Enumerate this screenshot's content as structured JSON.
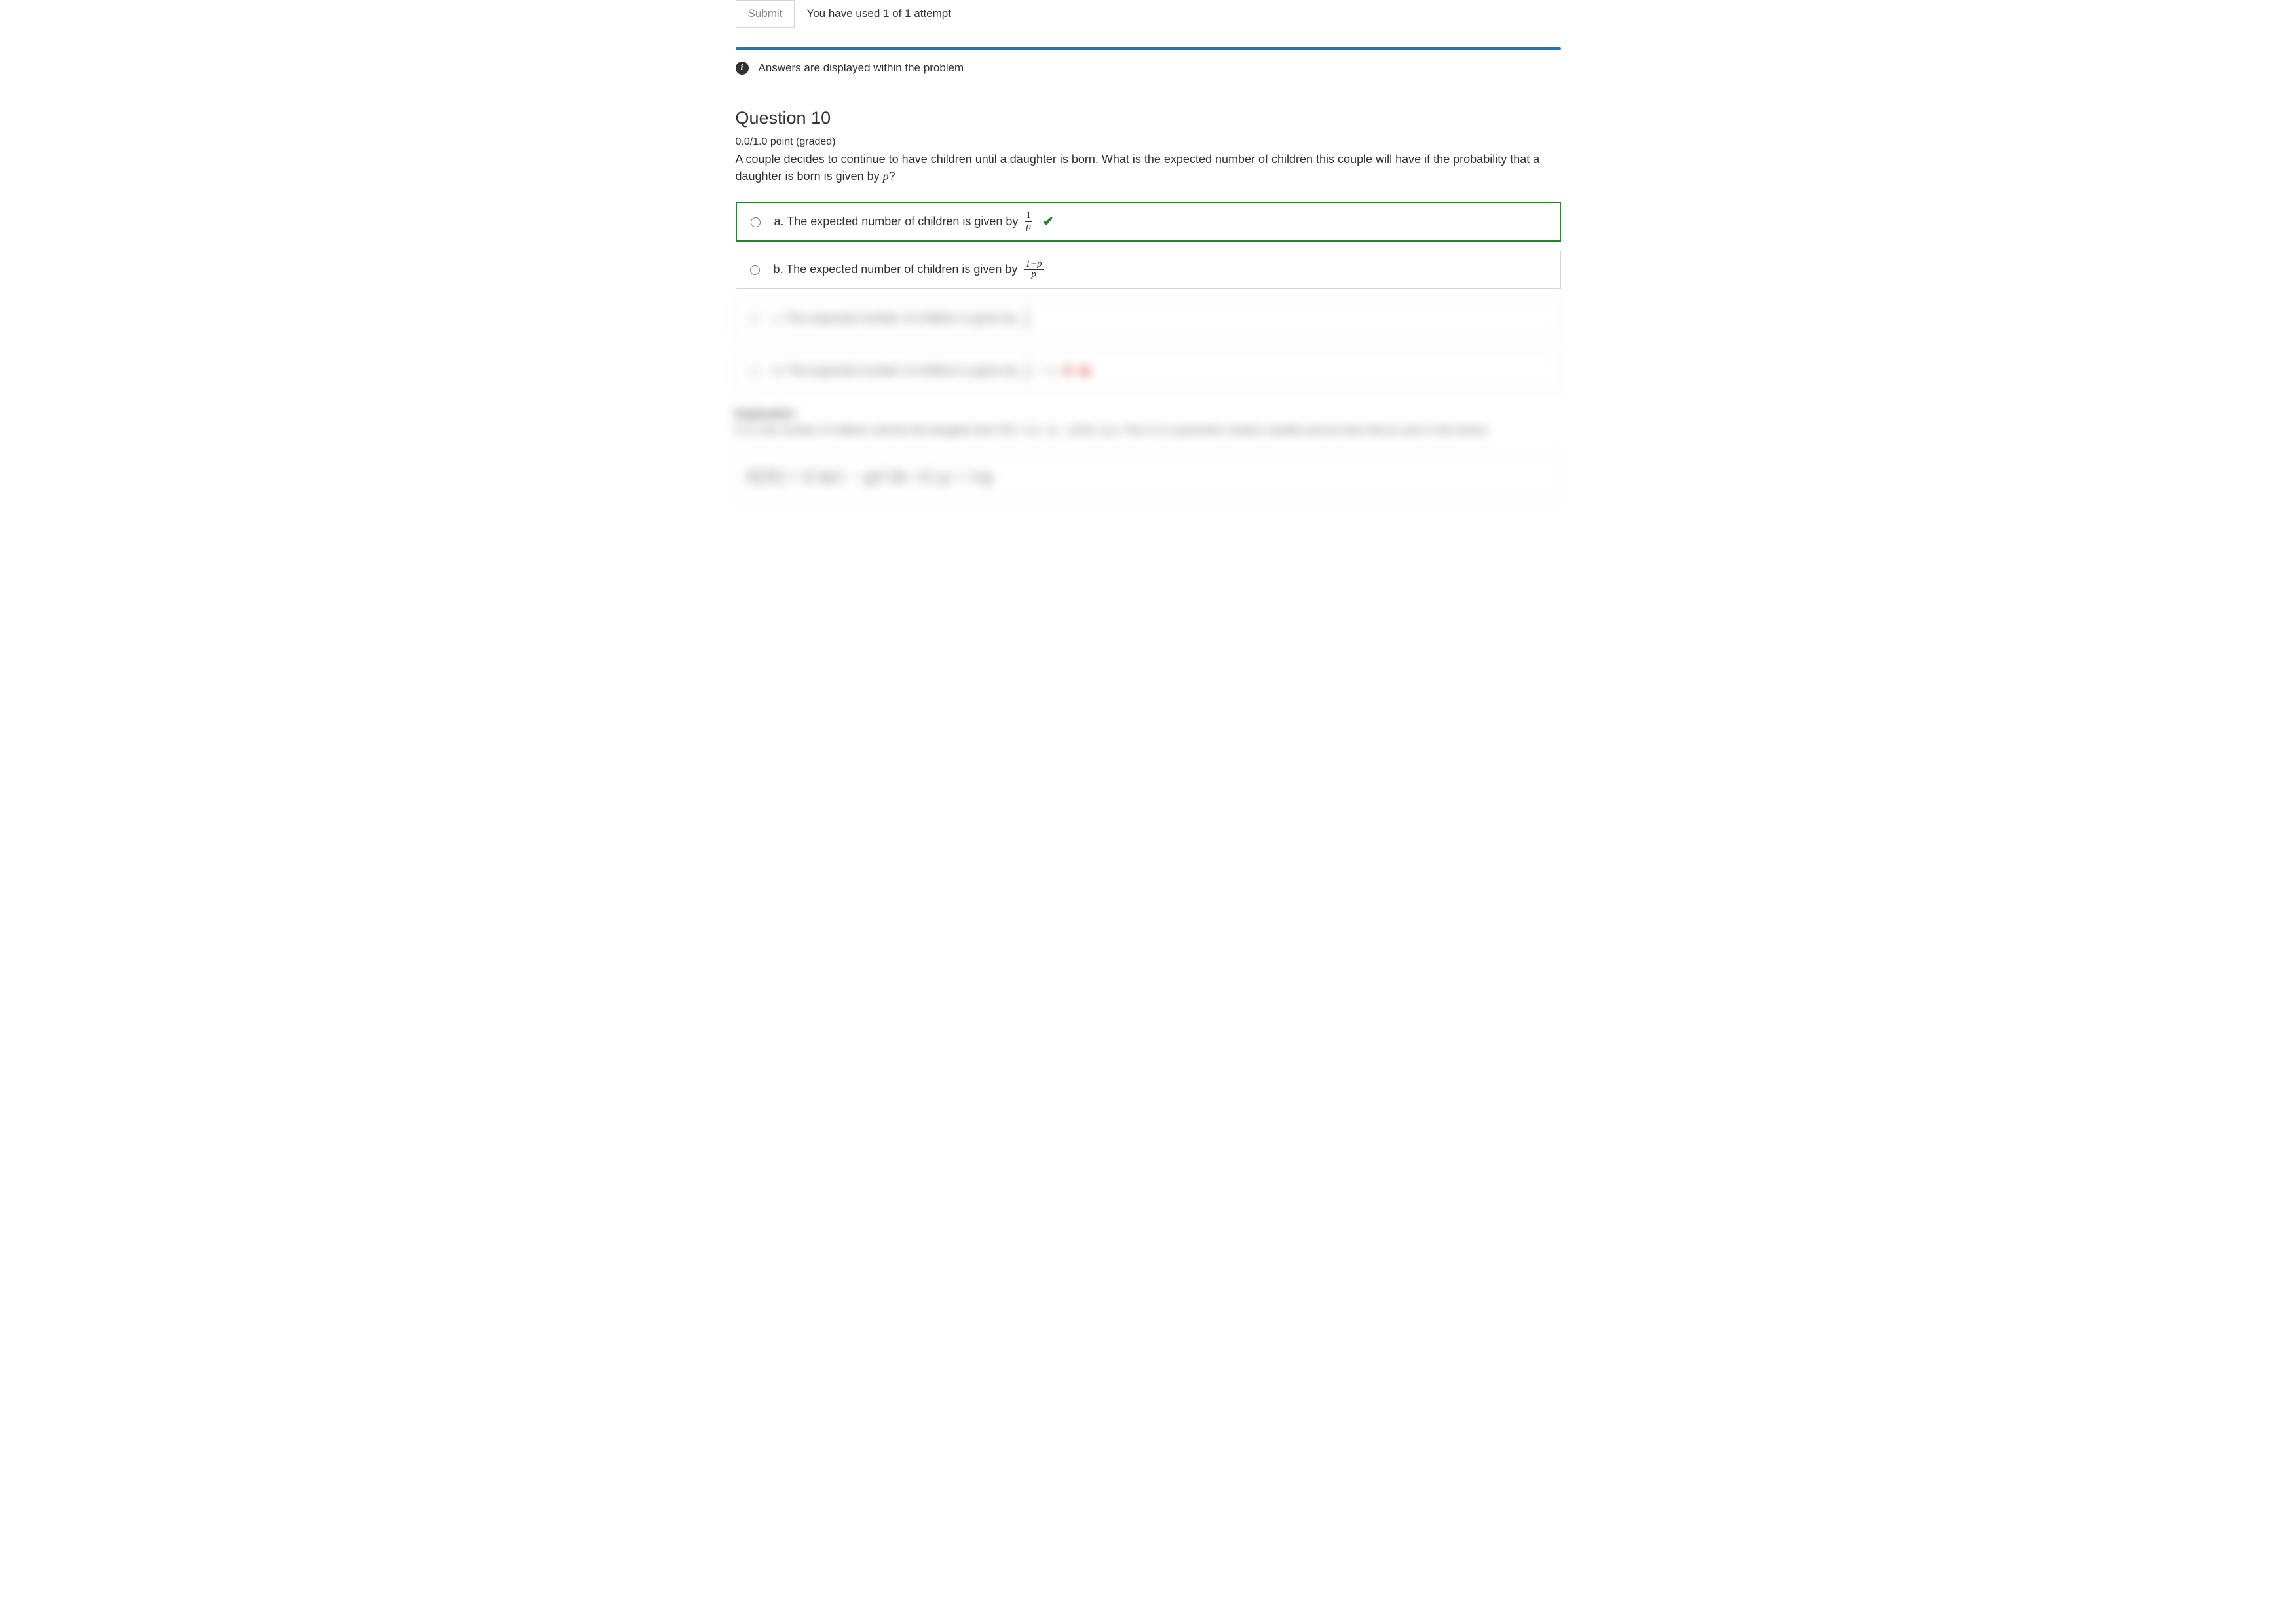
{
  "submit": {
    "button_label": "Submit",
    "attempt_text": "You have used 1 of 1 attempt"
  },
  "info_banner": "Answers are displayed within the problem",
  "question": {
    "title": "Question 10",
    "score_line": "0.0/1.0 point (graded)",
    "body_prefix": "A couple decides to continue to have children until a daughter is born. What is the expected number of children this couple will have if the probability that a daughter is born is given by ",
    "body_var": "p",
    "body_suffix": "?"
  },
  "choices": {
    "a": {
      "text": "a. The expected number of children is given by",
      "frac_num": "1",
      "frac_den": "p"
    },
    "b": {
      "text": "b. The expected number of children is given by",
      "frac_num": "1−p",
      "frac_den": "p"
    },
    "c": {
      "text": "c. The expected number of children is given by",
      "frac_num": "1",
      "frac_den": "p"
    },
    "d": {
      "text": "d. The expected number of children is given by",
      "frac_num": "1",
      "frac_den": "p",
      "extra": "− 1"
    }
  },
  "explanation": {
    "heading": "Explanation",
    "body": "If X is the number of children until the first daughter then P(X = k) = (1 − p)^{k−1} p. Thus X is a geometric random variable and we have that as seen in the lecture",
    "formula": "E[X] = Σ k(1 − p)^{k−1} p = 1/p"
  }
}
